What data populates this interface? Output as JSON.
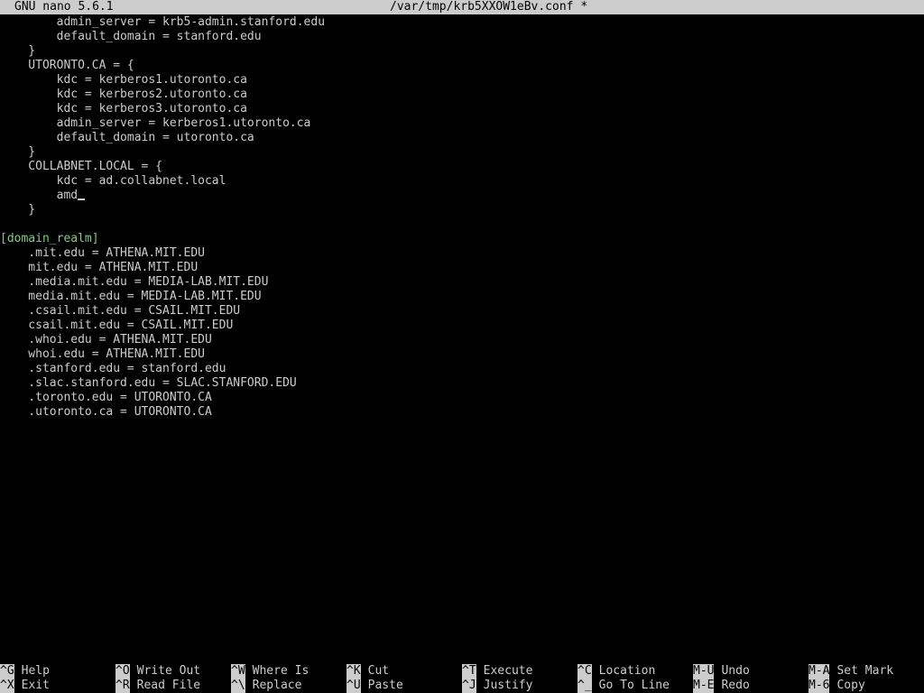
{
  "titlebar": {
    "app": "GNU nano 5.6.1",
    "file": "/var/tmp/krb5XXOW1eBv.conf *"
  },
  "editor": {
    "lines": [
      "        admin_server = krb5-admin.stanford.edu",
      "        default_domain = stanford.edu",
      "    }",
      "    UTORONTO.CA = {",
      "        kdc = kerberos1.utoronto.ca",
      "        kdc = kerberos2.utoronto.ca",
      "        kdc = kerberos3.utoronto.ca",
      "        admin_server = kerberos1.utoronto.ca",
      "        default_domain = utoronto.ca",
      "    }",
      "    COLLABNET.LOCAL = {",
      "        kdc = ad.collabnet.local",
      "        amd",
      "    }",
      "",
      "[domain_realm]",
      "    .mit.edu = ATHENA.MIT.EDU",
      "    mit.edu = ATHENA.MIT.EDU",
      "    .media.mit.edu = MEDIA-LAB.MIT.EDU",
      "    media.mit.edu = MEDIA-LAB.MIT.EDU",
      "    .csail.mit.edu = CSAIL.MIT.EDU",
      "    csail.mit.edu = CSAIL.MIT.EDU",
      "    .whoi.edu = ATHENA.MIT.EDU",
      "    whoi.edu = ATHENA.MIT.EDU",
      "    .stanford.edu = stanford.edu",
      "    .slac.stanford.edu = SLAC.STANFORD.EDU",
      "    .toronto.edu = UTORONTO.CA",
      "    .utoronto.ca = UTORONTO.CA"
    ],
    "section_line_index": 15,
    "cursor_line_index": 12
  },
  "shortcuts": [
    {
      "key": "^G",
      "label": "Help",
      "name": "help"
    },
    {
      "key": "^X",
      "label": "Exit",
      "name": "exit"
    },
    {
      "key": "^O",
      "label": "Write Out",
      "name": "write-out"
    },
    {
      "key": "^R",
      "label": "Read File",
      "name": "read-file"
    },
    {
      "key": "^W",
      "label": "Where Is",
      "name": "where-is"
    },
    {
      "key": "^\\",
      "label": "Replace",
      "name": "replace"
    },
    {
      "key": "^K",
      "label": "Cut",
      "name": "cut"
    },
    {
      "key": "^U",
      "label": "Paste",
      "name": "paste"
    },
    {
      "key": "^T",
      "label": "Execute",
      "name": "execute"
    },
    {
      "key": "^J",
      "label": "Justify",
      "name": "justify"
    },
    {
      "key": "^C",
      "label": "Location",
      "name": "location"
    },
    {
      "key": "^_",
      "label": "Go To Line",
      "name": "go-to-line"
    },
    {
      "key": "M-U",
      "label": "Undo",
      "name": "undo"
    },
    {
      "key": "M-E",
      "label": "Redo",
      "name": "redo"
    },
    {
      "key": "M-A",
      "label": "Set Mark",
      "name": "set-mark"
    },
    {
      "key": "M-6",
      "label": "Copy",
      "name": "copy"
    }
  ]
}
